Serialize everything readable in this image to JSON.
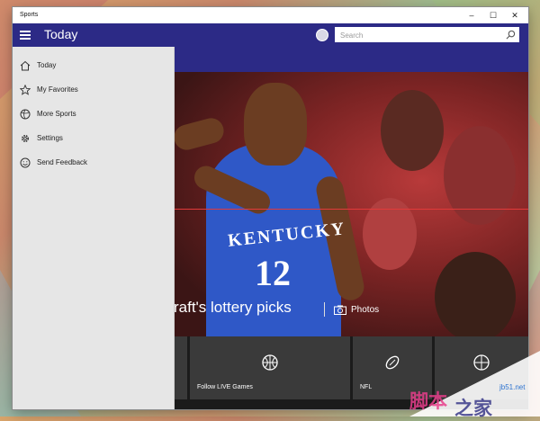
{
  "window": {
    "title": "Sports"
  },
  "titlebar_buttons": {
    "minimize": "–",
    "maximize": "☐",
    "close": "✕"
  },
  "appbar": {
    "title": "Today"
  },
  "search": {
    "placeholder": "Search"
  },
  "nav": {
    "items": [
      {
        "label": "Today",
        "icon": "home-icon"
      },
      {
        "label": "My Favorites",
        "icon": "star-icon"
      },
      {
        "label": "More Sports",
        "icon": "ball-icon"
      },
      {
        "label": "Settings",
        "icon": "gear-icon"
      },
      {
        "label": "Send Feedback",
        "icon": "smiley-icon"
      }
    ]
  },
  "hero": {
    "headline": "raft's lottery picks",
    "photos_label": "Photos",
    "jersey_text": "KENTUCKY",
    "jersey_number": "12"
  },
  "tiles": [
    {
      "label": "Follow LIVE Games",
      "icon": "basketball-icon"
    },
    {
      "label": "NFL",
      "icon": "football-icon"
    },
    {
      "label": "",
      "icon": "basketball-icon"
    }
  ],
  "watermark": {
    "text1": "脚本",
    "text2": "之家",
    "text3": "jb51.net"
  },
  "colors": {
    "accent": "#2c2a86",
    "nav_bg": "#e6e6e6",
    "guide_line": "#e23a3a"
  }
}
